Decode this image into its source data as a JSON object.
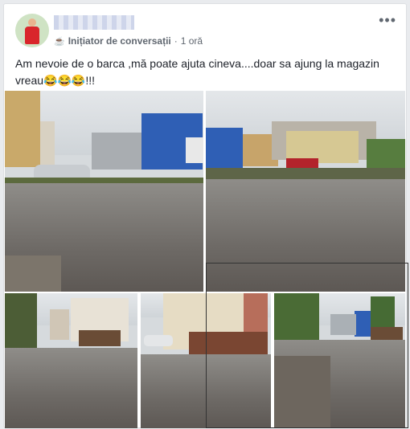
{
  "post": {
    "meta_icon": "coffee-cup-icon",
    "role": "Inițiator de conversații",
    "separator": "·",
    "time": "1 oră",
    "more_label": "•••",
    "text_line1": "Am nevoie de o barca ,mă poate ajuta cineva....doar sa ajung la magazin",
    "text_line2_prefix": "vreau",
    "emoji": "😂😂😂",
    "text_line2_suffix": "!!!"
  },
  "photos": {
    "count": 5,
    "icons": [
      "photo-1",
      "photo-2",
      "photo-3",
      "photo-4",
      "photo-5"
    ]
  }
}
